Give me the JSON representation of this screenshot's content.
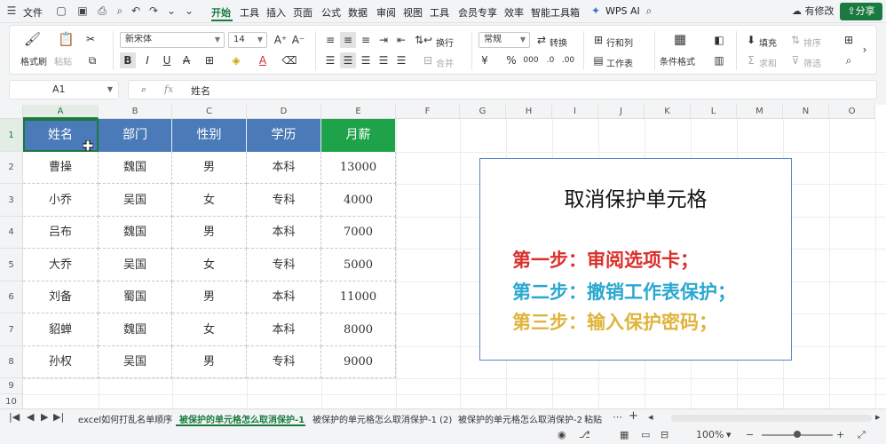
{
  "menubar": {
    "file_label": "文件",
    "items": [
      "开始",
      "工具",
      "插入",
      "页面",
      "公式",
      "数据",
      "审阅",
      "视图",
      "工具",
      "会员专享",
      "效率",
      "智能工具箱"
    ],
    "wps_ai": "WPS AI",
    "modify_label": "有修改",
    "share_label": "分享"
  },
  "ribbon": {
    "format_painter": "格式刷",
    "paste": "粘贴",
    "font_name": "新宋体",
    "font_size": "14",
    "wrap": "换行",
    "merge": "合并",
    "number_format": "常规",
    "convert": "转换",
    "row_col": "行和列",
    "worksheet": "工作表",
    "cond_format": "条件格式",
    "fill": "填充",
    "sort": "排序",
    "sum": "求和",
    "filter": "筛选"
  },
  "formula_bar": {
    "cell_ref": "A1",
    "fx": "fx",
    "value": "姓名"
  },
  "columns": [
    "A",
    "B",
    "C",
    "D",
    "E",
    "F",
    "G",
    "H",
    "I",
    "J",
    "K",
    "L",
    "M",
    "N",
    "O"
  ],
  "rows": [
    "1",
    "2",
    "3",
    "4",
    "5",
    "6",
    "7",
    "8",
    "9",
    "10"
  ],
  "table": {
    "headers": [
      "姓名",
      "部门",
      "性别",
      "学历",
      "月薪"
    ],
    "data": [
      [
        "曹操",
        "魏国",
        "男",
        "本科",
        "13000"
      ],
      [
        "小乔",
        "吴国",
        "女",
        "专科",
        "4000"
      ],
      [
        "吕布",
        "魏国",
        "男",
        "本科",
        "7000"
      ],
      [
        "大乔",
        "吴国",
        "女",
        "专科",
        "5000"
      ],
      [
        "刘备",
        "蜀国",
        "男",
        "本科",
        "11000"
      ],
      [
        "貂蝉",
        "魏国",
        "女",
        "本科",
        "8000"
      ],
      [
        "孙权",
        "吴国",
        "男",
        "专科",
        "9000"
      ]
    ]
  },
  "textbox": {
    "title": "取消保护单元格",
    "step1": "第一步：审阅选项卡；",
    "step2": "第二步：撤销工作表保护；",
    "step3": "第三步：输入保护密码；"
  },
  "colors": {
    "header_blue": "#4a7ab8",
    "header_green": "#1ea34a",
    "step1": "#d9302c",
    "step2": "#2aa8cf",
    "step3": "#e0b43c",
    "accent": "#1a7a3f"
  },
  "sheet_tabs": [
    "excel如何打乱名单顺序",
    "被保护的单元格怎么取消保护-1",
    "被保护的单元格怎么取消保护-1 (2)",
    "被保护的单元格怎么取消保护-2",
    "粘贴"
  ],
  "status": {
    "zoom": "100%"
  }
}
